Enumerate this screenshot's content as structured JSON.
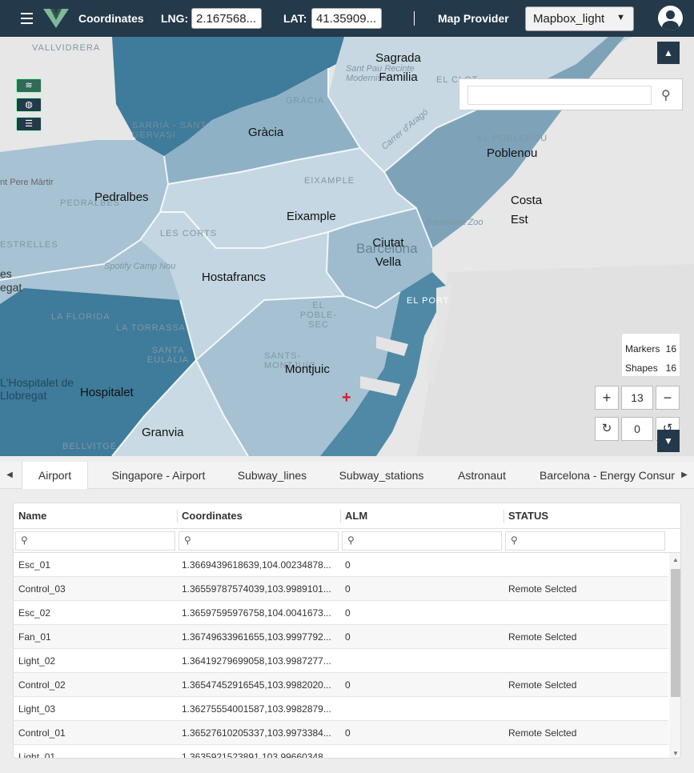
{
  "header": {
    "title": "Coordinates",
    "lng_label": "LNG:",
    "lng_value": "2.167568...",
    "lat_label": "LAT:",
    "lat_value": "41.35909...",
    "provider_label": "Map Provider",
    "provider_value": "Mapbox_light"
  },
  "map": {
    "districts": [
      "Sagrada Familia",
      "Gràcia",
      "Poblenou",
      "Pedralbes",
      "Eixample",
      "Costa Est",
      "Ciutat Vella",
      "Hostafrancs",
      "Montjuic",
      "Hospitalet",
      "Granvia"
    ],
    "faint_labels": [
      "VALLVIDRERA",
      "SARRIÀ - SANT GERVASI",
      "GRÀCIA",
      "Sant Pau Recinte Modernista",
      "EL CLOT",
      "Carrer d'Aragó",
      "EL POBLENOU",
      "EIXAMPLE",
      "nt Pere Màrtir",
      "PEDRALBES",
      "LES CORTS",
      "Barcelona Zoo",
      "ESTRELLES",
      "Spotify Camp Nou",
      "EL POBLE-SEC",
      "EL PORT",
      "LA FLORIDA",
      "LA TORRASSA",
      "SANTS-MONTJUÏC",
      "SANTA EULÀLIA",
      "L'Hospitalet de Llobregat",
      "BELLVITGE",
      "es",
      "egat"
    ],
    "city": "Barcelona",
    "search_placeholder": "",
    "markers_label": "Markers",
    "markers_count": "16",
    "shapes_label": "Shapes",
    "shapes_count": "16",
    "zoom": "13",
    "rotation": "0"
  },
  "tabs": [
    "Airport",
    "Singapore - Airport",
    "Subway_lines",
    "Subway_stations",
    "Astronaut",
    "Barcelona - Energy Consum"
  ],
  "table": {
    "columns": [
      "Name",
      "Coordinates",
      "ALM",
      "STATUS"
    ],
    "rows": [
      [
        "Esc_01",
        "1.3669439618639,104.00234878...",
        "0",
        ""
      ],
      [
        "Control_03",
        "1.36559787574039,103.9989101...",
        "0",
        "Remote Selcted"
      ],
      [
        "Esc_02",
        "1.36597595976758,104.0041673...",
        "0",
        ""
      ],
      [
        "Fan_01",
        "1.36749633961655,103.9997792...",
        "0",
        "Remote Selcted"
      ],
      [
        "Light_02",
        "1.36419279699058,103.9987277...",
        "",
        ""
      ],
      [
        "Control_02",
        "1.36547452916545,103.9982020...",
        "0",
        "Remote Selcted"
      ],
      [
        "Light_03",
        "1.36275554001587,103.9982879...",
        "",
        ""
      ],
      [
        "Control_01",
        "1.36527610205337,103.9973384...",
        "0",
        "Remote Selcted"
      ],
      [
        "Light_01",
        "1.3635921523891,103.99660348...",
        "",
        ""
      ]
    ]
  },
  "colors": {
    "header_bg": "#24394a",
    "district_dark": "#3f7b9a",
    "district_mid": "#8eb0c4",
    "district_light": "#bfd3df",
    "marker": "#e0182a"
  }
}
